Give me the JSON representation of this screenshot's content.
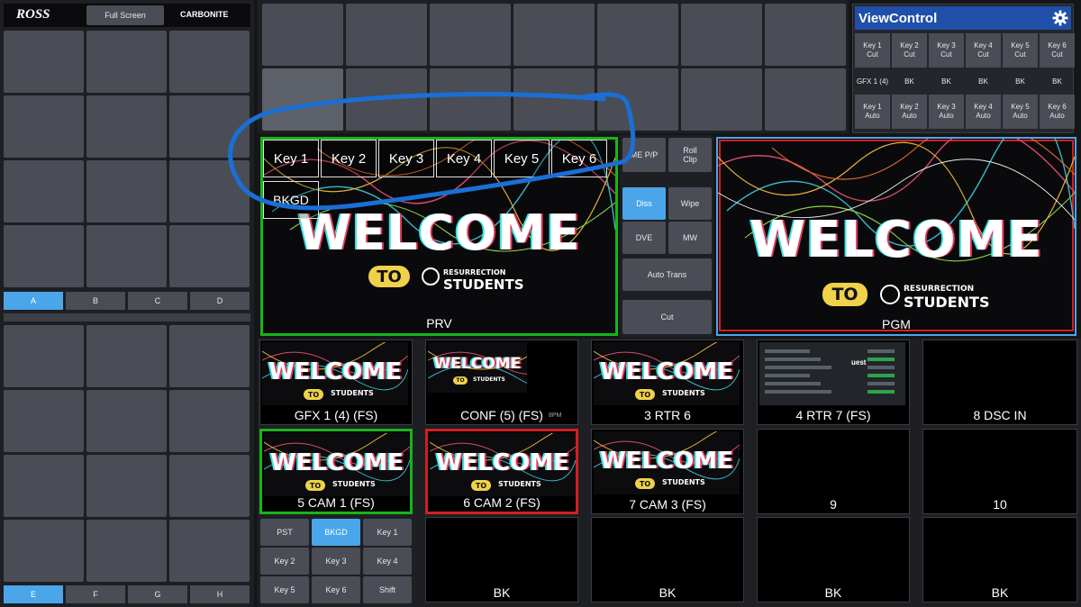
{
  "header": {
    "logo": "ROSS",
    "fullscreen_label": "Full Screen",
    "brand": "CARBONITE"
  },
  "left_top_tabs": [
    {
      "label": "A",
      "active": true
    },
    {
      "label": "B",
      "active": false
    },
    {
      "label": "C",
      "active": false
    },
    {
      "label": "D",
      "active": false
    }
  ],
  "left_bottom_tabs": [
    {
      "label": "E",
      "active": true
    },
    {
      "label": "F",
      "active": false
    },
    {
      "label": "G",
      "active": false
    },
    {
      "label": "H",
      "active": false
    }
  ],
  "viewcontrol": {
    "title": "ViewControl",
    "icon": "gear-icon",
    "cut_row": [
      "Key 1\nCut",
      "Key 2\nCut",
      "Key 3\nCut",
      "Key 4\nCut",
      "Key 5\nCut",
      "Key 6\nCut"
    ],
    "status_row": [
      "GFX 1 (4)",
      "BK",
      "BK",
      "BK",
      "BK",
      "BK"
    ],
    "auto_row": [
      "Key 1\nAuto",
      "Key 2\nAuto",
      "Key 3\nAuto",
      "Key 4\nAuto",
      "Key 5\nAuto",
      "Key 6\nAuto"
    ]
  },
  "preview": {
    "label": "PRV",
    "key_overlays": [
      "Key 1",
      "Key 2",
      "Key 3",
      "Key 4",
      "Key 5",
      "Key 6"
    ],
    "bkgd_label": "BKGD",
    "slide_title": "WELCOME",
    "slide_to": "TO",
    "slide_org_top": "RESURRECTION",
    "slide_org_bottom": "STUDENTS"
  },
  "program": {
    "label": "PGM",
    "slide_title": "WELCOME",
    "slide_to": "TO",
    "slide_org_top": "RESURRECTION",
    "slide_org_bottom": "STUDENTS"
  },
  "transition": {
    "me_pp": "ME P/P",
    "roll_clip": "Roll\nClip",
    "diss": "Diss",
    "wipe": "Wipe",
    "dve": "DVE",
    "mw": "MW",
    "auto_trans": "Auto Trans",
    "cut": "Cut",
    "active": "diss"
  },
  "sources": [
    {
      "label": "GFX 1 (4) (FS)",
      "state": "none",
      "thumb": "welcome"
    },
    {
      "label": "CONF (5) (FS)",
      "state": "none",
      "thumb": "welcome-small"
    },
    {
      "label": "3 RTR 6",
      "state": "none",
      "thumb": "welcome"
    },
    {
      "label": "4 RTR 7 (FS)",
      "state": "none",
      "thumb": "ui"
    },
    {
      "label": "8 DSC IN",
      "state": "none",
      "thumb": "black"
    },
    {
      "label": "5 CAM 1 (FS)",
      "state": "prv",
      "thumb": "welcome"
    },
    {
      "label": "6 CAM 2 (FS)",
      "state": "pgm",
      "thumb": "welcome"
    },
    {
      "label": "7 CAM 3 (FS)",
      "state": "none",
      "thumb": "welcome"
    },
    {
      "label": "9",
      "state": "none",
      "thumb": "black"
    },
    {
      "label": "10",
      "state": "none",
      "thumb": "black"
    },
    {
      "label": "BK",
      "state": "none",
      "thumb": "black"
    },
    {
      "label": "BK",
      "state": "none",
      "thumb": "black"
    },
    {
      "label": "BK",
      "state": "none",
      "thumb": "black"
    },
    {
      "label": "BK",
      "state": "none",
      "thumb": "black"
    }
  ],
  "thumb_texts": {
    "conf_time": "8PM",
    "rtr7_word": "uest"
  },
  "layer_buttons": [
    {
      "label": "PST",
      "active": false
    },
    {
      "label": "BKGD",
      "active": true
    },
    {
      "label": "Key 1",
      "active": false
    },
    {
      "label": "Key 2",
      "active": false
    },
    {
      "label": "Key 3",
      "active": false
    },
    {
      "label": "Key 4",
      "active": false
    },
    {
      "label": "Key 5",
      "active": false
    },
    {
      "label": "Key 6",
      "active": false
    },
    {
      "label": "Shift",
      "active": false
    }
  ],
  "colors": {
    "accent": "#4aa6e8",
    "preview_tally": "#17b517",
    "program_tally": "#d21f1f",
    "viewcontrol_header": "#1f4fa8",
    "annotation": "#1a6fd6"
  }
}
